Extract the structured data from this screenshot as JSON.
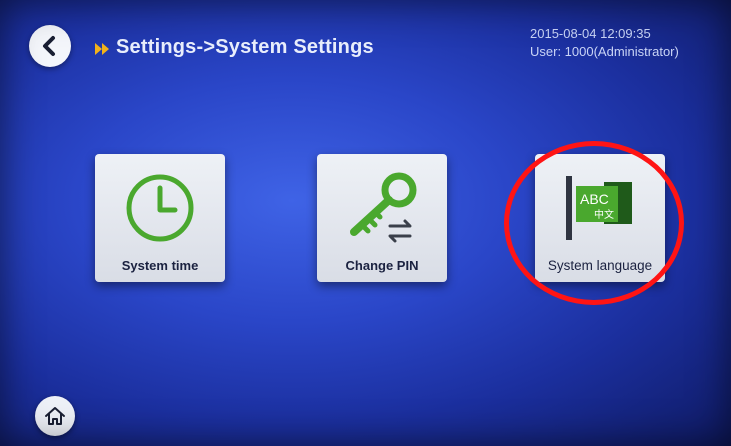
{
  "header": {
    "breadcrumb": "Settings->System Settings",
    "datetime": "2015-08-04  12:09:35",
    "user": "User: 1000(Administrator)"
  },
  "icons": {
    "back": "back-arrow-icon",
    "crumb": "double-chevron-right-icon",
    "home": "home-icon",
    "time": "clock-icon",
    "pin": "key-icon",
    "language": "language-flag-icon"
  },
  "tiles": [
    {
      "label": "System time"
    },
    {
      "label": "Change PIN"
    },
    {
      "label": "System language"
    }
  ],
  "language_icon": {
    "abc": "ABC",
    "chinese": "中文"
  },
  "colors": {
    "accent_green": "#4aa82e",
    "highlight": "#ff1414",
    "crumb_arrow": "#f3b21a",
    "background": "#2a46c8"
  }
}
